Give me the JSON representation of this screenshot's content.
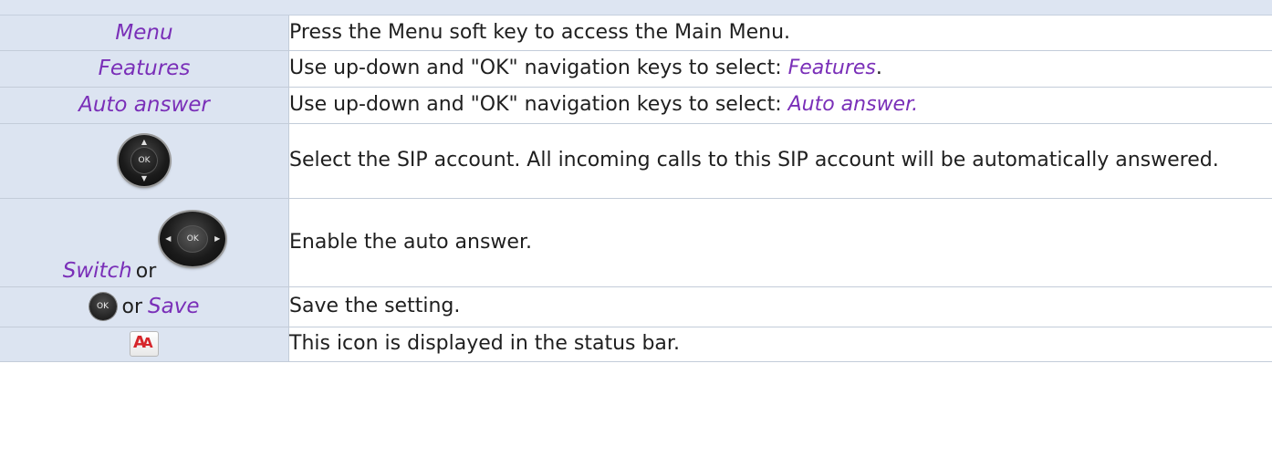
{
  "rows": [
    {
      "left": "Menu",
      "text": "Press the Menu soft key to access the Main Menu."
    },
    {
      "left": "Features",
      "text_before": "Use up-down and \"OK\" navigation keys to select: ",
      "text_em": "Features",
      "text_after": "."
    },
    {
      "left": "Auto answer",
      "text_before": "Use up-down and \"OK\" navigation keys to select: ",
      "text_em": "Auto answer."
    },
    {
      "left_icon": "navigation-key-up-down-icon",
      "left_icon_label": "OK",
      "text": "Select the SIP account. All incoming calls to this SIP account will be automatically answered."
    },
    {
      "left_em": "Switch",
      "left_or": "or",
      "left_icon": "navigation-key-left-right-icon",
      "left_icon_label": "OK",
      "text": "Enable the auto answer."
    },
    {
      "left_icon": "ok-key-icon",
      "left_icon_label": "OK",
      "left_or": "or",
      "left_em": "Save",
      "text": "Save the setting."
    },
    {
      "left_icon": "auto-answer-status-icon",
      "text": "This icon is displayed in the status bar."
    }
  ],
  "colors": {
    "left_bg": "#dce4f1",
    "keyword": "#7a2fb8",
    "aa_icon": "#d6262b"
  }
}
